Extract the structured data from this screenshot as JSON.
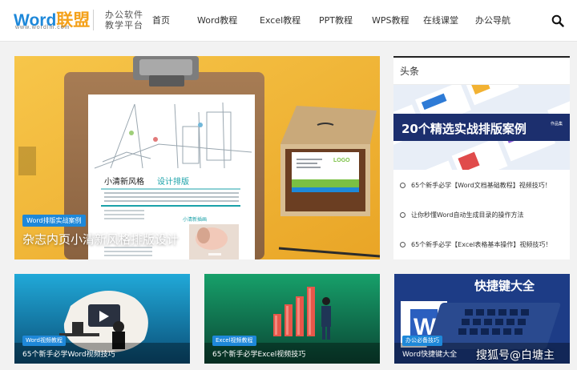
{
  "logo": {
    "word": "Word",
    "union": "联盟",
    "url": "www.wordlm.com"
  },
  "slogan": {
    "line1": "办公软件",
    "line2": "教学平台"
  },
  "nav": {
    "items": [
      {
        "label": "首页"
      },
      {
        "label": "Word教程"
      },
      {
        "label": "Excel教程"
      },
      {
        "label": "PPT教程"
      },
      {
        "label": "WPS教程"
      },
      {
        "label": "在线课堂"
      },
      {
        "label": "办公导航"
      }
    ],
    "search_icon": "search-icon"
  },
  "hero": {
    "tag": "Word排版实战案例",
    "title": "杂志内页小清新风格排版设计",
    "poster_heading": "小清新风格",
    "poster_heading_accent": "设计排版",
    "poster_sub": "小清新插画",
    "card_logo": "LOGO"
  },
  "headlines": {
    "title": "头条",
    "banner_text": "20个精选实战排版案例",
    "banner_side": "作品集",
    "items": [
      {
        "text": "65个新手必学【Word文档基础教程】视频技巧！"
      },
      {
        "text": "让你秒懂Word自动生成目录的操作方法"
      },
      {
        "text": "65个新手必学【Excel表格基本操作】视频技巧！"
      }
    ]
  },
  "cards": [
    {
      "tag": "Word视频教程",
      "title": "65个新手必学Word视频技巧"
    },
    {
      "tag": "Excel视频教程",
      "title": "65个新手必学Excel视频技巧"
    },
    {
      "tag": "办公必备技巧",
      "title": "Word快捷键大全",
      "banner": "快捷键大全"
    }
  ],
  "watermark": "搜狐号@白塘主",
  "colors": {
    "brand_blue": "#1e88d9",
    "brand_orange": "#f4a11a",
    "hero_yellow": "#f0b63a"
  }
}
